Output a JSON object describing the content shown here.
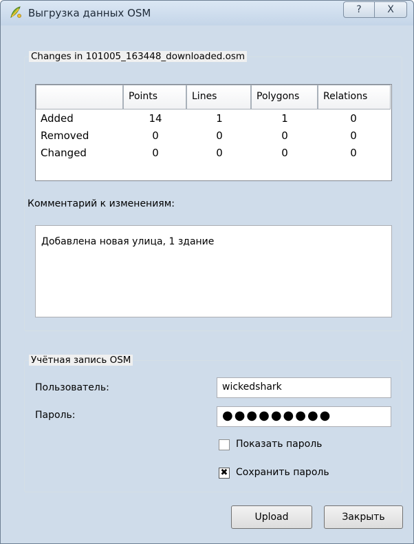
{
  "window": {
    "title": "Выгрузка данных OSM",
    "help_glyph": "?",
    "close_glyph": "X"
  },
  "changes": {
    "legend": "Changes in 101005_163448_downloaded.osm",
    "columns": [
      "",
      "Points",
      "Lines",
      "Polygons",
      "Relations"
    ],
    "rows": [
      {
        "label": "Added",
        "values": [
          "14",
          "1",
          "1",
          "0"
        ]
      },
      {
        "label": "Removed",
        "values": [
          "0",
          "0",
          "0",
          "0"
        ]
      },
      {
        "label": "Changed",
        "values": [
          "0",
          "0",
          "0",
          "0"
        ]
      }
    ],
    "comment_label": "Комментарий к изменениям:",
    "comment_value": "Добавлена новая улица, 1 здание"
  },
  "account": {
    "legend": "Учётная запись OSM",
    "user_label": "Пользователь:",
    "user_value": "wickedshark",
    "password_label": "Пароль:",
    "password_mask": "●●●●●●●●●",
    "show_password_label": "Показать пароль",
    "show_password_checked": false,
    "save_password_label": "Сохранить пароль",
    "save_password_checked": true,
    "check_glyph": "✖"
  },
  "buttons": {
    "upload": "Upload",
    "close": "Закрыть"
  }
}
